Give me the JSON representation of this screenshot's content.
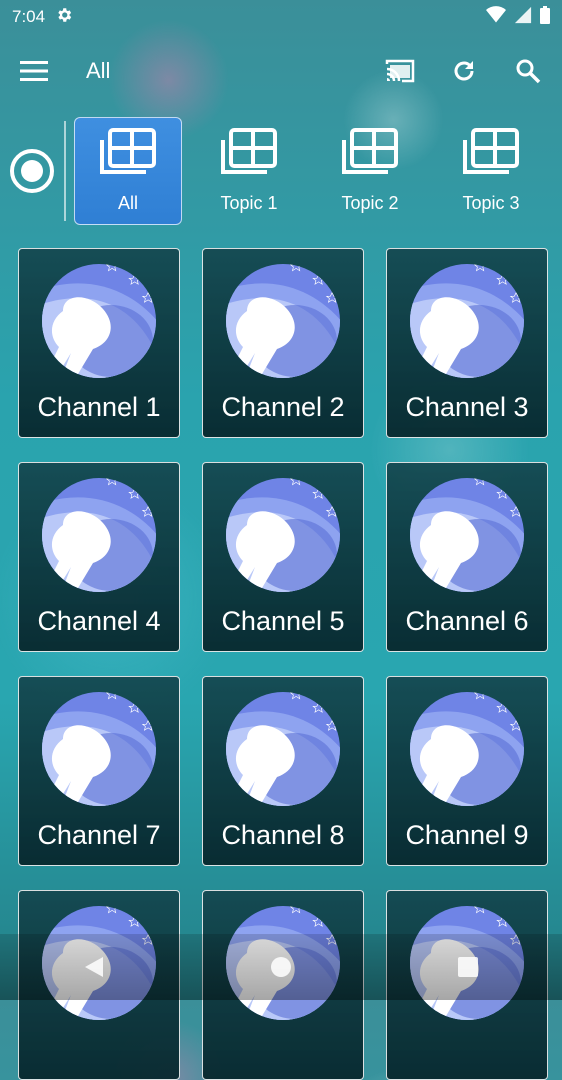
{
  "status": {
    "time": "7:04",
    "settings_icon": "gear-icon",
    "icons": [
      "wifi-icon",
      "signal-icon",
      "battery-icon"
    ]
  },
  "appbar": {
    "title": "All",
    "menu_icon": "menu-icon",
    "actions": [
      "cast-icon",
      "refresh-icon",
      "search-icon"
    ]
  },
  "tabs": [
    {
      "label": "All",
      "icon": "grid-icon",
      "active": true
    },
    {
      "label": "Topic 1",
      "icon": "grid-icon",
      "active": false
    },
    {
      "label": "Topic 2",
      "icon": "grid-icon",
      "active": false
    },
    {
      "label": "Topic 3",
      "icon": "grid-icon",
      "active": false
    }
  ],
  "channels": [
    {
      "label": "Channel 1"
    },
    {
      "label": "Channel 2"
    },
    {
      "label": "Channel 3"
    },
    {
      "label": "Channel 4"
    },
    {
      "label": "Channel 5"
    },
    {
      "label": "Channel 6"
    },
    {
      "label": "Channel 7"
    },
    {
      "label": "Channel 8"
    },
    {
      "label": "Channel 9"
    },
    {
      "label": ""
    },
    {
      "label": ""
    },
    {
      "label": ""
    }
  ],
  "navbar": [
    "back-icon",
    "home-icon",
    "recents-icon"
  ],
  "colors": {
    "active_tab": "#3a8ee0",
    "logo_circle": "#6a7fe0",
    "card_bg": "#0f3b42"
  }
}
